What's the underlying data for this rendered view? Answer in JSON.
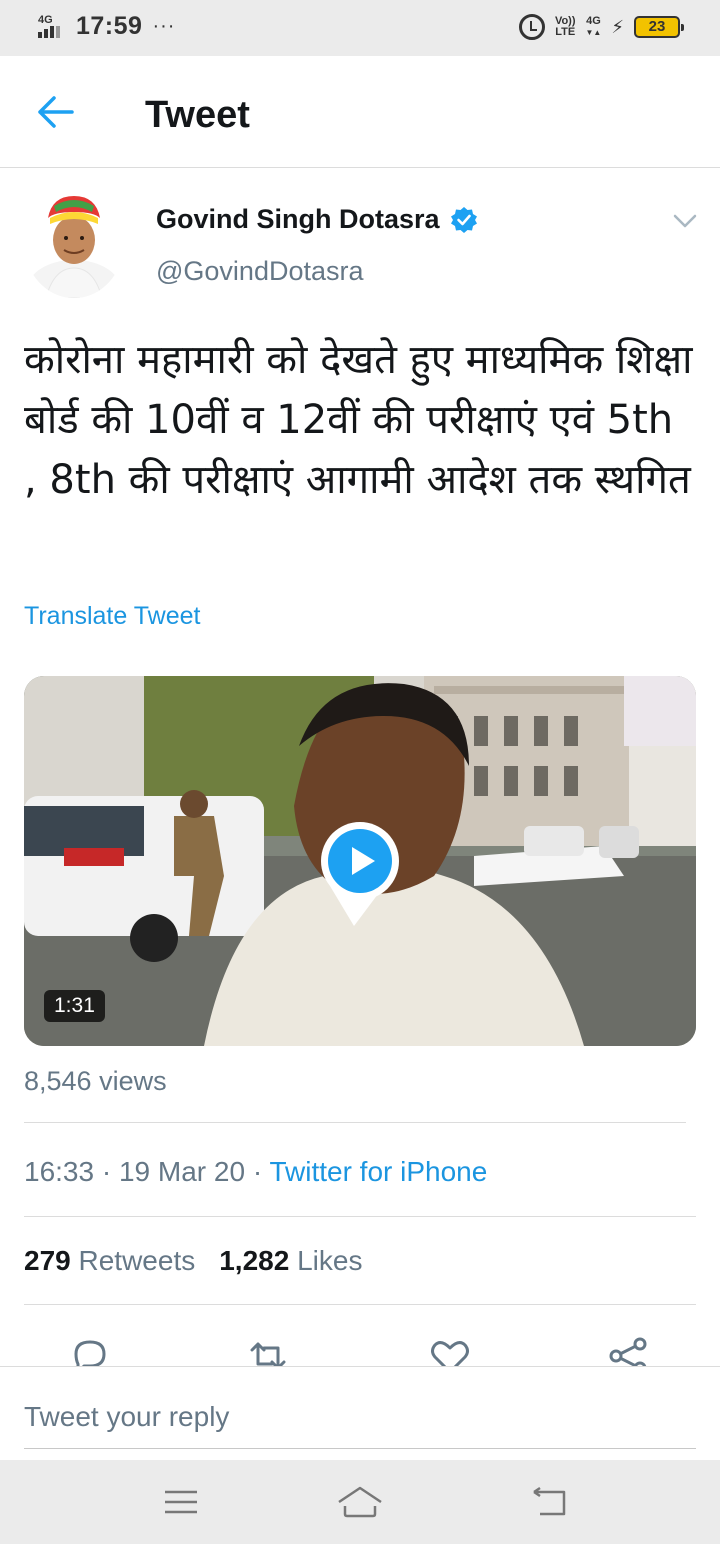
{
  "status_bar": {
    "network": "4G",
    "time": "17:59",
    "dots": "···",
    "volte_top": "Vo))",
    "volte_bottom": "LTE",
    "data_top": "4G",
    "data_bottom": "▼▲",
    "battery": "23"
  },
  "header": {
    "title": "Tweet"
  },
  "tweet": {
    "author_name": "Govind Singh Dotasra",
    "author_handle": "@GovindDotasra",
    "text": "कोरोना महामारी को देखते हुए माध्यमिक शिक्षा बोर्ड की 10वीं व 12वीं की परीक्षाएं एवं 5th , 8th की परीक्षाएं आगामी आदेश तक स्थगित",
    "translate_label": "Translate Tweet",
    "video_duration": "1:31",
    "views": "8,546 views",
    "time": "16:33",
    "date": "19 Mar 20",
    "client": "Twitter for iPhone",
    "retweets_count": "279",
    "retweets_label": "Retweets",
    "likes_count": "1,282",
    "likes_label": "Likes"
  },
  "reply": {
    "placeholder": "Tweet your reply"
  },
  "colors": {
    "accent": "#1da1f2",
    "link": "#1b95e0",
    "secondary_text": "#657786",
    "primary_text": "#14171a"
  },
  "icons": [
    "back-arrow-icon",
    "verified-badge-icon",
    "chevron-down-icon",
    "play-icon",
    "reply-icon",
    "retweet-icon",
    "like-icon",
    "share-icon",
    "menu-icon",
    "home-icon",
    "back-icon"
  ]
}
